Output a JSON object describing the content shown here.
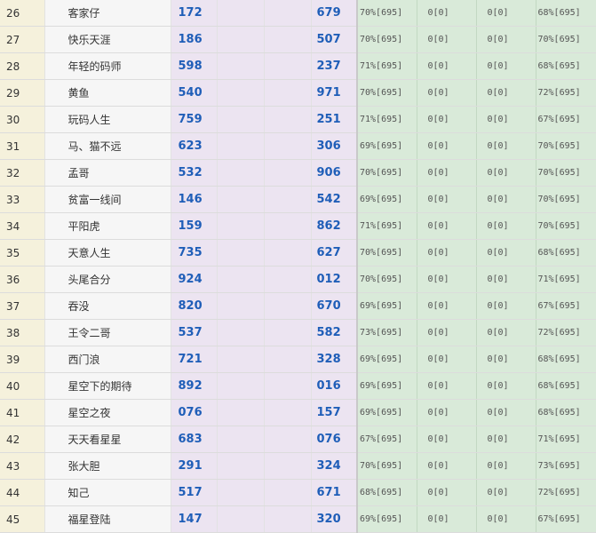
{
  "rows": [
    {
      "idx": "26",
      "name": "客家仔",
      "v1": "172",
      "v2": "679",
      "p1": "70%[695]",
      "z1": "0[0]",
      "z2": "0[0]",
      "p2": "68%[695]"
    },
    {
      "idx": "27",
      "name": "快乐天涯",
      "v1": "186",
      "v2": "507",
      "p1": "70%[695]",
      "z1": "0[0]",
      "z2": "0[0]",
      "p2": "70%[695]"
    },
    {
      "idx": "28",
      "name": "年轻的码师",
      "v1": "598",
      "v2": "237",
      "p1": "71%[695]",
      "z1": "0[0]",
      "z2": "0[0]",
      "p2": "68%[695]"
    },
    {
      "idx": "29",
      "name": "黄鱼",
      "v1": "540",
      "v2": "971",
      "p1": "70%[695]",
      "z1": "0[0]",
      "z2": "0[0]",
      "p2": "72%[695]"
    },
    {
      "idx": "30",
      "name": "玩码人生",
      "v1": "759",
      "v2": "251",
      "p1": "71%[695]",
      "z1": "0[0]",
      "z2": "0[0]",
      "p2": "67%[695]"
    },
    {
      "idx": "31",
      "name": "马、猫不远",
      "v1": "623",
      "v2": "306",
      "p1": "69%[695]",
      "z1": "0[0]",
      "z2": "0[0]",
      "p2": "70%[695]"
    },
    {
      "idx": "32",
      "name": "孟哥",
      "v1": "532",
      "v2": "906",
      "p1": "70%[695]",
      "z1": "0[0]",
      "z2": "0[0]",
      "p2": "70%[695]"
    },
    {
      "idx": "33",
      "name": "贫富一线间",
      "v1": "146",
      "v2": "542",
      "p1": "69%[695]",
      "z1": "0[0]",
      "z2": "0[0]",
      "p2": "70%[695]"
    },
    {
      "idx": "34",
      "name": "平阳虎",
      "v1": "159",
      "v2": "862",
      "p1": "71%[695]",
      "z1": "0[0]",
      "z2": "0[0]",
      "p2": "70%[695]"
    },
    {
      "idx": "35",
      "name": "天意人生",
      "v1": "735",
      "v2": "627",
      "p1": "70%[695]",
      "z1": "0[0]",
      "z2": "0[0]",
      "p2": "68%[695]"
    },
    {
      "idx": "36",
      "name": "头尾合分",
      "v1": "924",
      "v2": "012",
      "p1": "70%[695]",
      "z1": "0[0]",
      "z2": "0[0]",
      "p2": "71%[695]"
    },
    {
      "idx": "37",
      "name": "吞没",
      "v1": "820",
      "v2": "670",
      "p1": "69%[695]",
      "z1": "0[0]",
      "z2": "0[0]",
      "p2": "67%[695]"
    },
    {
      "idx": "38",
      "name": "王令二哥",
      "v1": "537",
      "v2": "582",
      "p1": "73%[695]",
      "z1": "0[0]",
      "z2": "0[0]",
      "p2": "72%[695]"
    },
    {
      "idx": "39",
      "name": "西门浪",
      "v1": "721",
      "v2": "328",
      "p1": "69%[695]",
      "z1": "0[0]",
      "z2": "0[0]",
      "p2": "68%[695]"
    },
    {
      "idx": "40",
      "name": "星空下的期待",
      "v1": "892",
      "v2": "016",
      "p1": "69%[695]",
      "z1": "0[0]",
      "z2": "0[0]",
      "p2": "68%[695]"
    },
    {
      "idx": "41",
      "name": "星空之夜",
      "v1": "076",
      "v2": "157",
      "p1": "69%[695]",
      "z1": "0[0]",
      "z2": "0[0]",
      "p2": "68%[695]"
    },
    {
      "idx": "42",
      "name": "天天看星星",
      "v1": "683",
      "v2": "076",
      "p1": "67%[695]",
      "z1": "0[0]",
      "z2": "0[0]",
      "p2": "71%[695]"
    },
    {
      "idx": "43",
      "name": "张大胆",
      "v1": "291",
      "v2": "324",
      "p1": "70%[695]",
      "z1": "0[0]",
      "z2": "0[0]",
      "p2": "73%[695]"
    },
    {
      "idx": "44",
      "name": "知己",
      "v1": "517",
      "v2": "671",
      "p1": "68%[695]",
      "z1": "0[0]",
      "z2": "0[0]",
      "p2": "72%[695]"
    },
    {
      "idx": "45",
      "name": "福星登陆",
      "v1": "147",
      "v2": "320",
      "p1": "69%[695]",
      "z1": "0[0]",
      "z2": "0[0]",
      "p2": "67%[695]"
    }
  ]
}
